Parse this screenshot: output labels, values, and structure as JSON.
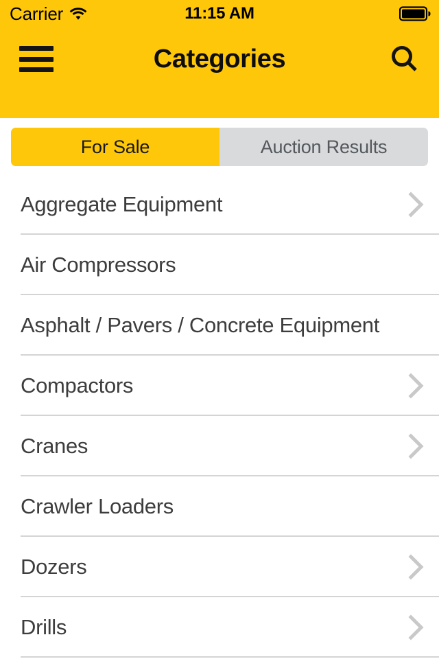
{
  "status_bar": {
    "carrier": "Carrier",
    "wifi_icon": "wifi-icon",
    "time": "11:15 AM",
    "battery_icon": "battery-full-icon"
  },
  "nav_bar": {
    "menu_icon": "hamburger-menu-icon",
    "title": "Categories",
    "search_icon": "search-icon"
  },
  "segmented_control": {
    "selected": "For Sale",
    "segments": [
      {
        "label": "For Sale",
        "active": true
      },
      {
        "label": "Auction Results",
        "active": false
      }
    ]
  },
  "colors": {
    "brand_yellow": "#ffc709",
    "segment_inactive": "#d8dadc",
    "row_text": "#3d3d3d",
    "separator": "#d4d4d4",
    "chevron": "#c9c9c9"
  },
  "category_list": {
    "items": [
      {
        "label": "Aggregate Equipment",
        "chevron": true
      },
      {
        "label": "Air Compressors",
        "chevron": false
      },
      {
        "label": "Asphalt / Pavers / Concrete Equipment",
        "chevron": false
      },
      {
        "label": "Compactors",
        "chevron": true
      },
      {
        "label": "Cranes",
        "chevron": true
      },
      {
        "label": "Crawler Loaders",
        "chevron": false
      },
      {
        "label": "Dozers",
        "chevron": true
      },
      {
        "label": "Drills",
        "chevron": true
      }
    ]
  }
}
